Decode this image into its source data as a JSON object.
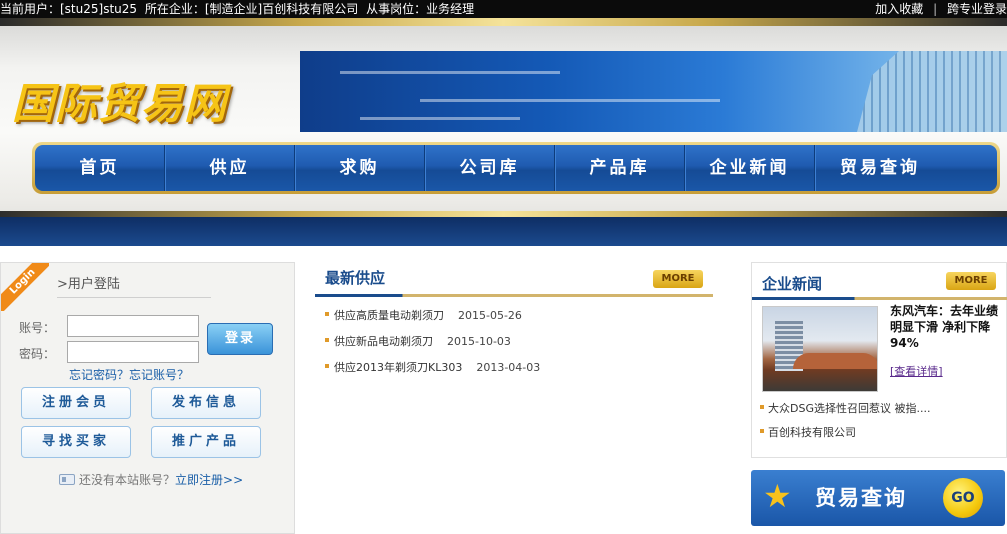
{
  "topbar": {
    "current_user": "当前用户：[stu25]stu25",
    "company": "所在企业：[制造企业]百创科技有限公司",
    "position": "从事岗位：业务经理",
    "add_favorite": "加入收藏",
    "separator": "|",
    "pro_login": "跨专业登录"
  },
  "header": {
    "logo_text": "国际贸易网",
    "nav": [
      "首页",
      "供应",
      "求购",
      "公司库",
      "产品库",
      "企业新闻",
      "贸易查询"
    ]
  },
  "login": {
    "ribbon": "Login",
    "title": ">用户登陆",
    "username_label": "账号：",
    "password_label": "密码：",
    "username_value": "",
    "password_value": "",
    "submit": "登录",
    "forgot": "忘记密码？忘记账号？",
    "buttons": [
      "注册会员",
      "发布信息",
      "寻找买家",
      "推广产品"
    ],
    "no_account": "还没有本站账号？",
    "register_link": "立即注册>>"
  },
  "supply": {
    "title": "最新供应",
    "more": "MORE",
    "items": [
      {
        "name": "供应高质量电动剃须刀",
        "date": "2015-05-26"
      },
      {
        "name": "供应新品电动剃须刀",
        "date": "2015-10-03"
      },
      {
        "name": "供应2013年剃须刀KL303",
        "date": "2013-04-03"
      }
    ]
  },
  "news": {
    "title": "企业新闻",
    "more": "MORE",
    "headline": "东风汽车：去年业绩明显下滑 净利下降94%",
    "detail": "[查看详情]",
    "items": [
      "大众DSG选择性召回惹议 被指....",
      "百创科技有限公司"
    ]
  },
  "trade": {
    "label": "贸易查询",
    "go": "GO"
  }
}
